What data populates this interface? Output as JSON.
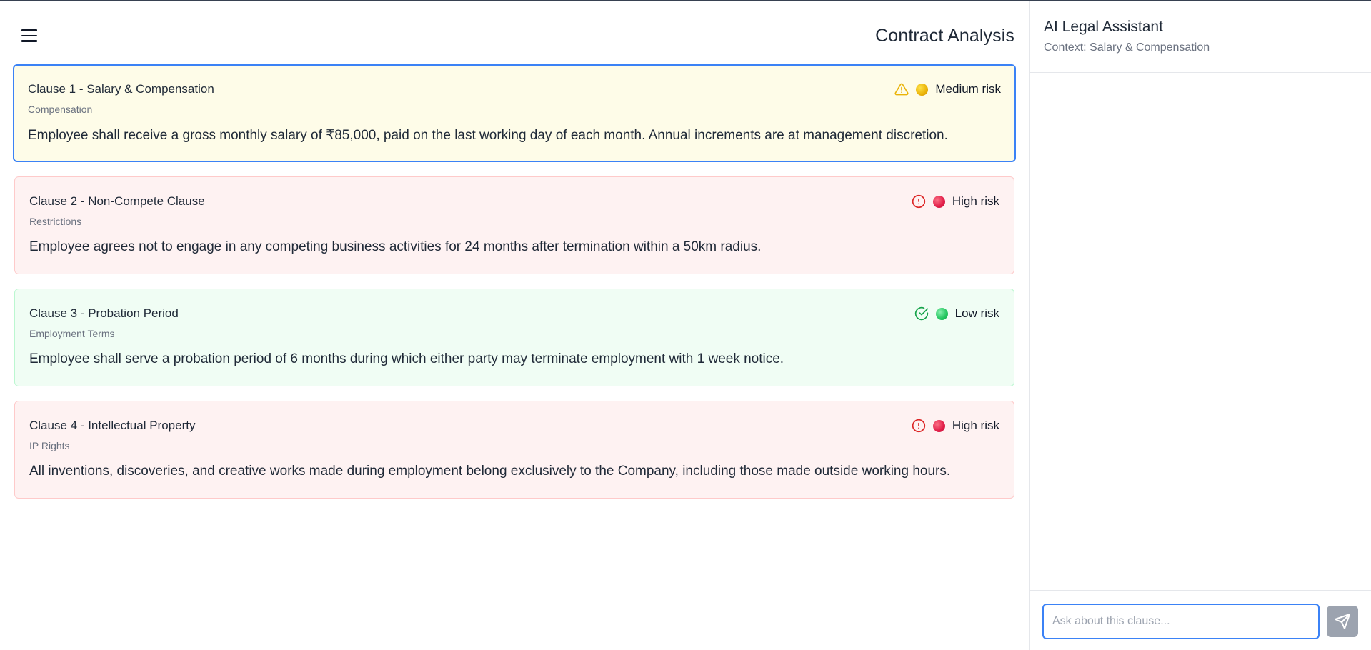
{
  "header": {
    "title": "Contract Analysis",
    "menu_icon": "hamburger-menu-icon"
  },
  "clauses": [
    {
      "title": "Clause 1 - Salary & Compensation",
      "category": "Compensation",
      "text": "Employee shall receive a gross monthly salary of ₹85,000, paid on the last working day of each month. Annual increments are at management discretion.",
      "risk_label": "Medium risk",
      "risk_level": "medium",
      "risk_icon": "warning-triangle-icon",
      "selected": true
    },
    {
      "title": "Clause 2 - Non-Compete Clause",
      "category": "Restrictions",
      "text": "Employee agrees not to engage in any competing business activities for 24 months after termination within a 50km radius.",
      "risk_label": "High risk",
      "risk_level": "high",
      "risk_icon": "alert-circle-icon",
      "selected": false
    },
    {
      "title": "Clause 3 - Probation Period",
      "category": "Employment Terms",
      "text": "Employee shall serve a probation period of 6 months during which either party may terminate employment with 1 week notice.",
      "risk_label": "Low risk",
      "risk_level": "low",
      "risk_icon": "check-circle-icon",
      "selected": false
    },
    {
      "title": "Clause 4 - Intellectual Property",
      "category": "IP Rights",
      "text": "All inventions, discoveries, and creative works made during employment belong exclusively to the Company, including those made outside working hours.",
      "risk_label": "High risk",
      "risk_level": "high",
      "risk_icon": "alert-circle-icon",
      "selected": false
    }
  ],
  "sidebar": {
    "title": "AI Legal Assistant",
    "context": "Context: Salary & Compensation",
    "input_placeholder": "Ask about this clause...",
    "input_value": "",
    "send_icon": "send-icon"
  },
  "colors": {
    "accent": "#3b82f6",
    "medium_dot": "#eab308",
    "high_dot": "#e11d48",
    "low_dot": "#22c55e",
    "medium_icon": "#eab308",
    "high_icon": "#dc2626",
    "low_icon": "#16a34a"
  }
}
